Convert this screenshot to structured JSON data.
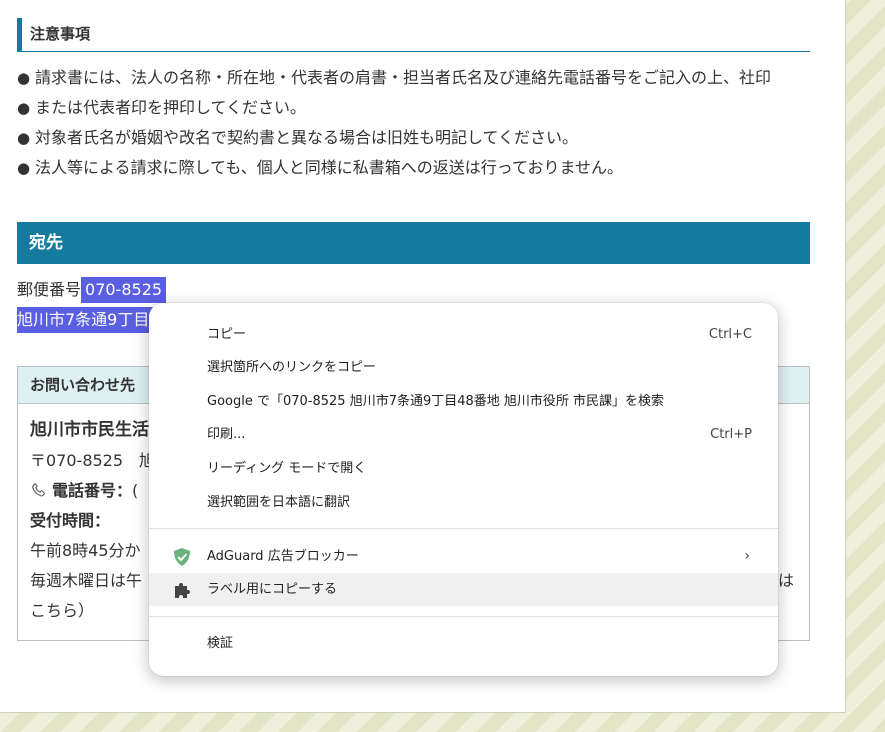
{
  "notice": {
    "heading": "注意事項",
    "items": [
      "請求書には、法人の名称・所在地・代表者の肩書・担当者氏名及び連絡先電話番号をご記入の上、社印",
      "または代表者印を押印してください。",
      "対象者氏名が婚姻や改名で契約書と異なる場合は旧姓も明記してください。",
      "法人等による請求に際しても、個人と同様に私書箱への返送は行っておりません。"
    ]
  },
  "address": {
    "heading": "宛先",
    "postal_label": "郵便番号",
    "postal_code": "070-8525",
    "line2_visible": "旭川市7条通9丁目"
  },
  "contact": {
    "heading": "お問い合わせ先",
    "office_name": "旭川市市民生活",
    "postal_line": "〒070-8525　旭",
    "phone_label": "電話番号：",
    "phone_value": "(",
    "hours_label": "受付時間：",
    "hours_value": "午前8時45分か",
    "thursday_note": "毎週木曜日は午",
    "thursday_tail": "は",
    "link_tail": "こちら）"
  },
  "context_menu": {
    "items": [
      {
        "label": "コピー",
        "shortcut": "Ctrl+C"
      },
      {
        "label": "選択箇所へのリンクをコピー"
      },
      {
        "label": "Google で「070-8525  旭川市7条通9丁目48番地 旭川市役所 市民課」を検索"
      },
      {
        "label": "印刷...",
        "shortcut": "Ctrl+P"
      },
      {
        "label": "リーディング モードで開く"
      },
      {
        "label": "選択範囲を日本語に翻訳"
      },
      {
        "label": "AdGuard 広告ブロッカー",
        "icon": "adguard-shield-icon",
        "submenu": "›"
      },
      {
        "label": "ラベル用にコピーする",
        "icon": "puzzle-extension-icon"
      },
      {
        "label": "検証"
      }
    ]
  },
  "colors": {
    "accent": "#147a9e",
    "selection": "#5a5ee0",
    "adguard_green": "#67b279"
  }
}
